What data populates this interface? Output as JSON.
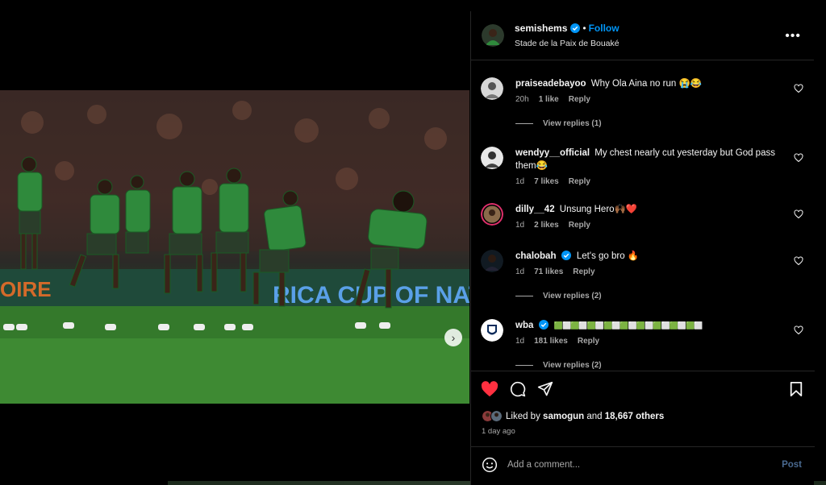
{
  "post": {
    "username": "semishems",
    "separator": "•",
    "follow_label": "Follow",
    "location": "Stade de la Paix de Bouaké",
    "more_label": "•••",
    "carousel_dots": 5,
    "active_dot": 0
  },
  "comments": [
    {
      "user": "praiseadebayoo",
      "text": "Why Ola Aina no run 😭😂",
      "time": "20h",
      "likes": "1 like",
      "reply": "Reply",
      "view_replies": "View replies (1)"
    },
    {
      "user": "wendyy__official",
      "text": "My chest nearly cut yesterday but God pass them😂",
      "time": "1d",
      "likes": "7 likes",
      "reply": "Reply"
    },
    {
      "user": "dilly__42",
      "text": "Unsung Hero🙌🏾❤️",
      "time": "1d",
      "likes": "2 likes",
      "reply": "Reply"
    },
    {
      "user": "chalobah",
      "text": "Let's go bro 🔥",
      "time": "1d",
      "likes": "71 likes",
      "reply": "Reply",
      "view_replies": "View replies (2)"
    },
    {
      "user": "wba",
      "text": "🟩⬜🟩⬜🟩⬜🟩⬜🟩⬜🟩⬜🟩⬜🟩⬜🟩⬜",
      "time": "1d",
      "likes": "181 likes",
      "reply": "Reply",
      "view_replies": "View replies (2)"
    }
  ],
  "likes": {
    "prefix": "Liked by",
    "user": "samogun",
    "conj": "and",
    "others": "18,667 others",
    "ago": "1 day ago"
  },
  "composer": {
    "placeholder": "Add a comment...",
    "post_label": "Post"
  },
  "colors": {
    "accent": "#0095f6",
    "heart": "#ff3040",
    "jersey": "#2e8b3a"
  }
}
